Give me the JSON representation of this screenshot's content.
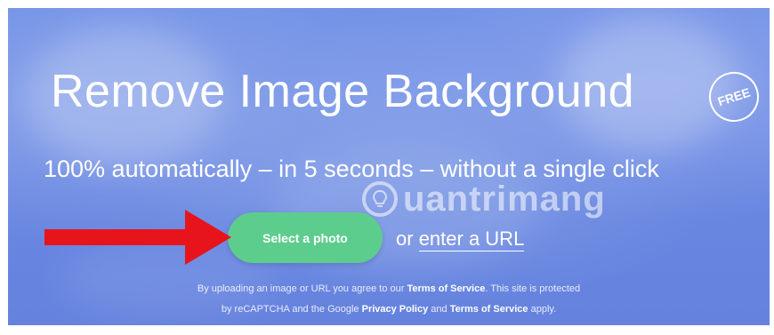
{
  "hero": {
    "title": "Remove Image Background",
    "badge": "FREE",
    "subtitle": "100% automatically – in 5 seconds – without a single click",
    "watermark": "uantrimang",
    "select_button": "Select a photo",
    "or_label": "or",
    "url_link": "enter a URL"
  },
  "legal": {
    "line1_prefix": "By uploading an image or URL you agree to our ",
    "line1_link": "Terms of Service",
    "line1_suffix": ". This site is protected",
    "line2_prefix": "by reCAPTCHA and the Google ",
    "line2_link1": "Privacy Policy",
    "line2_mid": " and ",
    "line2_link2": "Terms of Service",
    "line2_suffix": " apply."
  },
  "colors": {
    "background": "#6a88e2",
    "button": "#5dcd8e",
    "arrow": "#e8141b"
  },
  "icons": {
    "annotation": "red-arrow-icon",
    "watermark": "lightbulb-icon"
  }
}
